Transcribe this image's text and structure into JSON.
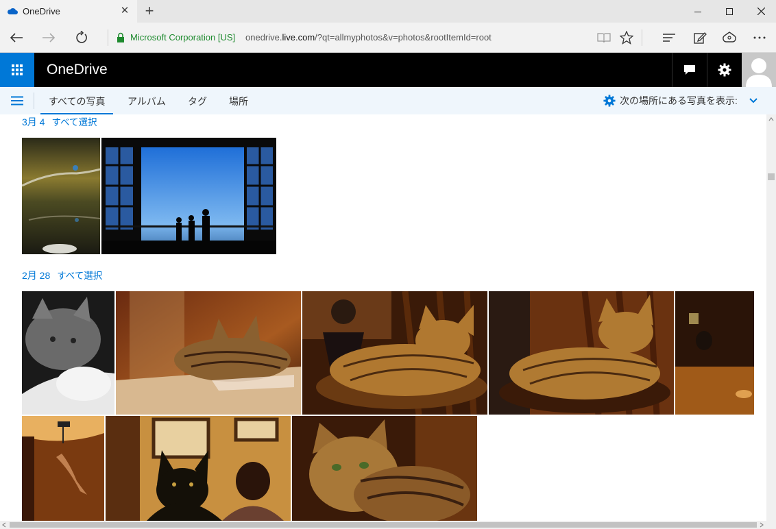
{
  "browser": {
    "tab_title": "OneDrive",
    "tab_close": "✕",
    "new_tab": "+",
    "address": {
      "org": "Microsoft Corporation [US]",
      "host_dim": "onedrive.",
      "host_main": "live.com",
      "path": "/?qt=allmyphotos&v=photos&rootItemId=root"
    }
  },
  "app": {
    "brand": "OneDrive",
    "accent": "#0078d7"
  },
  "nav": {
    "tabs": [
      {
        "label": "すべての写真"
      },
      {
        "label": "アルバム"
      },
      {
        "label": "タグ"
      },
      {
        "label": "場所"
      }
    ],
    "show_location": "次の場所にある写真を表示:"
  },
  "groups": [
    {
      "date": "3月 4",
      "select_all": "すべて選択"
    },
    {
      "date": "2月 28",
      "select_all": "すべて選択"
    }
  ]
}
